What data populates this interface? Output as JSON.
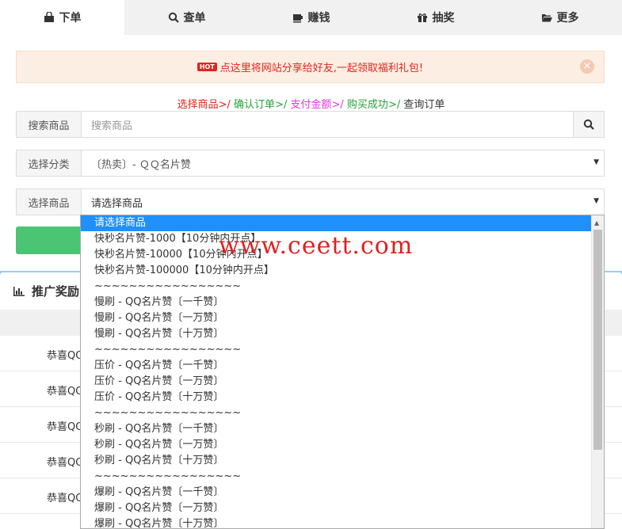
{
  "tabs": [
    {
      "label": "下单",
      "icon": "shopping-bag-icon",
      "active": true
    },
    {
      "label": "查单",
      "icon": "search-icon",
      "active": false
    },
    {
      "label": "赚钱",
      "icon": "money-icon",
      "active": false
    },
    {
      "label": "抽奖",
      "icon": "gift-icon",
      "active": false
    },
    {
      "label": "更多",
      "icon": "folder-open-icon",
      "active": false
    }
  ],
  "notice": {
    "badge": "HOT",
    "text": "点这里将网站分享给好友,一起领取福利礼包!"
  },
  "steps": [
    {
      "label": "选择商品",
      "color": "#e1251b"
    },
    {
      "label": "确认订单",
      "color": "#22a336"
    },
    {
      "label": "支付金额",
      "color": "#e036e0"
    },
    {
      "label": "购买成功",
      "color": "#22a336"
    },
    {
      "label": "查询订单",
      "color": "#333333"
    }
  ],
  "step_separator": ">/",
  "search": {
    "label": "搜索商品",
    "placeholder": "搜索商品"
  },
  "category": {
    "label": "选择分类",
    "value": "〔热卖〕- ＱＱ名片赞"
  },
  "product": {
    "label": "选择商品",
    "value": "请选择商品"
  },
  "panel": {
    "title": "推广奖励"
  },
  "ranking_rows": [
    "恭喜QQ",
    "恭喜QQ",
    "恭喜QQ",
    "恭喜QQ",
    "恭喜QQ"
  ],
  "dropdown_options": [
    "请选择商品",
    "快秒名片赞-1000【10分钟内开点】",
    "快秒名片赞-10000【10分钟内开点】",
    "快秒名片赞-100000【10分钟内开点】",
    "~~~~~~~~~~~~~~~~~",
    "慢刷 - QQ名片赞〔一千赞〕",
    "慢刷 - QQ名片赞〔一万赞〕",
    "慢刷 - QQ名片赞〔十万赞〕",
    "~~~~~~~~~~~~~~~~~",
    "压价 - QQ名片赞〔一千赞〕",
    "压价 - QQ名片赞〔一万赞〕",
    "压价 - QQ名片赞〔十万赞〕",
    "~~~~~~~~~~~~~~~~~",
    "秒刷 - QQ名片赞〔一千赞〕",
    "秒刷 - QQ名片赞〔一万赞〕",
    "秒刷 - QQ名片赞〔十万赞〕",
    "~~~~~~~~~~~~~~~~~",
    "爆刷 - QQ名片赞〔一千赞〕",
    "爆刷 - QQ名片赞〔一万赞〕",
    "爆刷 - QQ名片赞〔十万赞〕"
  ],
  "watermark": "www.ceett.com"
}
